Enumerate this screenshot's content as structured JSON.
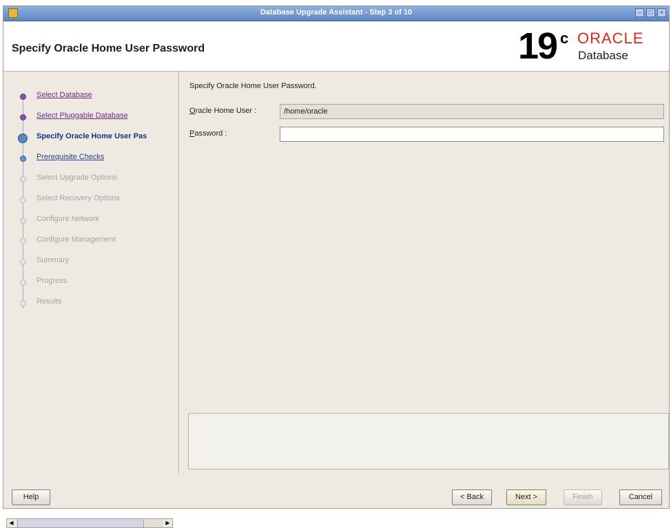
{
  "window": {
    "title": "Database Upgrade Assistant - Step 3 of 10",
    "controls": [
      "minimize-icon",
      "maximize-icon",
      "close-icon"
    ]
  },
  "header": {
    "page_title": "Specify Oracle Home User Password",
    "logo": {
      "version": "19",
      "superscript": "c",
      "brand": "ORACLE",
      "product": "Database",
      "brand_color": "#e0251b"
    }
  },
  "steps": [
    {
      "label": "Select Database",
      "state": "done"
    },
    {
      "label": "Select Pluggable Database",
      "state": "done"
    },
    {
      "label": "Specify Oracle Home User Pas",
      "state": "current"
    },
    {
      "label": "Prerequisite Checks",
      "state": "upcoming"
    },
    {
      "label": "Select Upgrade Options",
      "state": "disabled"
    },
    {
      "label": "Select Recovery Options",
      "state": "disabled"
    },
    {
      "label": "Configure Network",
      "state": "disabled"
    },
    {
      "label": "Configure Management",
      "state": "disabled"
    },
    {
      "label": "Summary",
      "state": "disabled"
    },
    {
      "label": "Progress",
      "state": "disabled"
    },
    {
      "label": "Results",
      "state": "disabled"
    }
  ],
  "content": {
    "instruction": "Specify Oracle Home User Password.",
    "home_user_label": "Oracle Home User :",
    "home_user_value": "/home/oracle",
    "password_label": "Password :",
    "password_value": ""
  },
  "buttons": {
    "help": "Help",
    "back": "< Back",
    "next": "Next >",
    "finish": "Finish",
    "cancel": "Cancel"
  }
}
